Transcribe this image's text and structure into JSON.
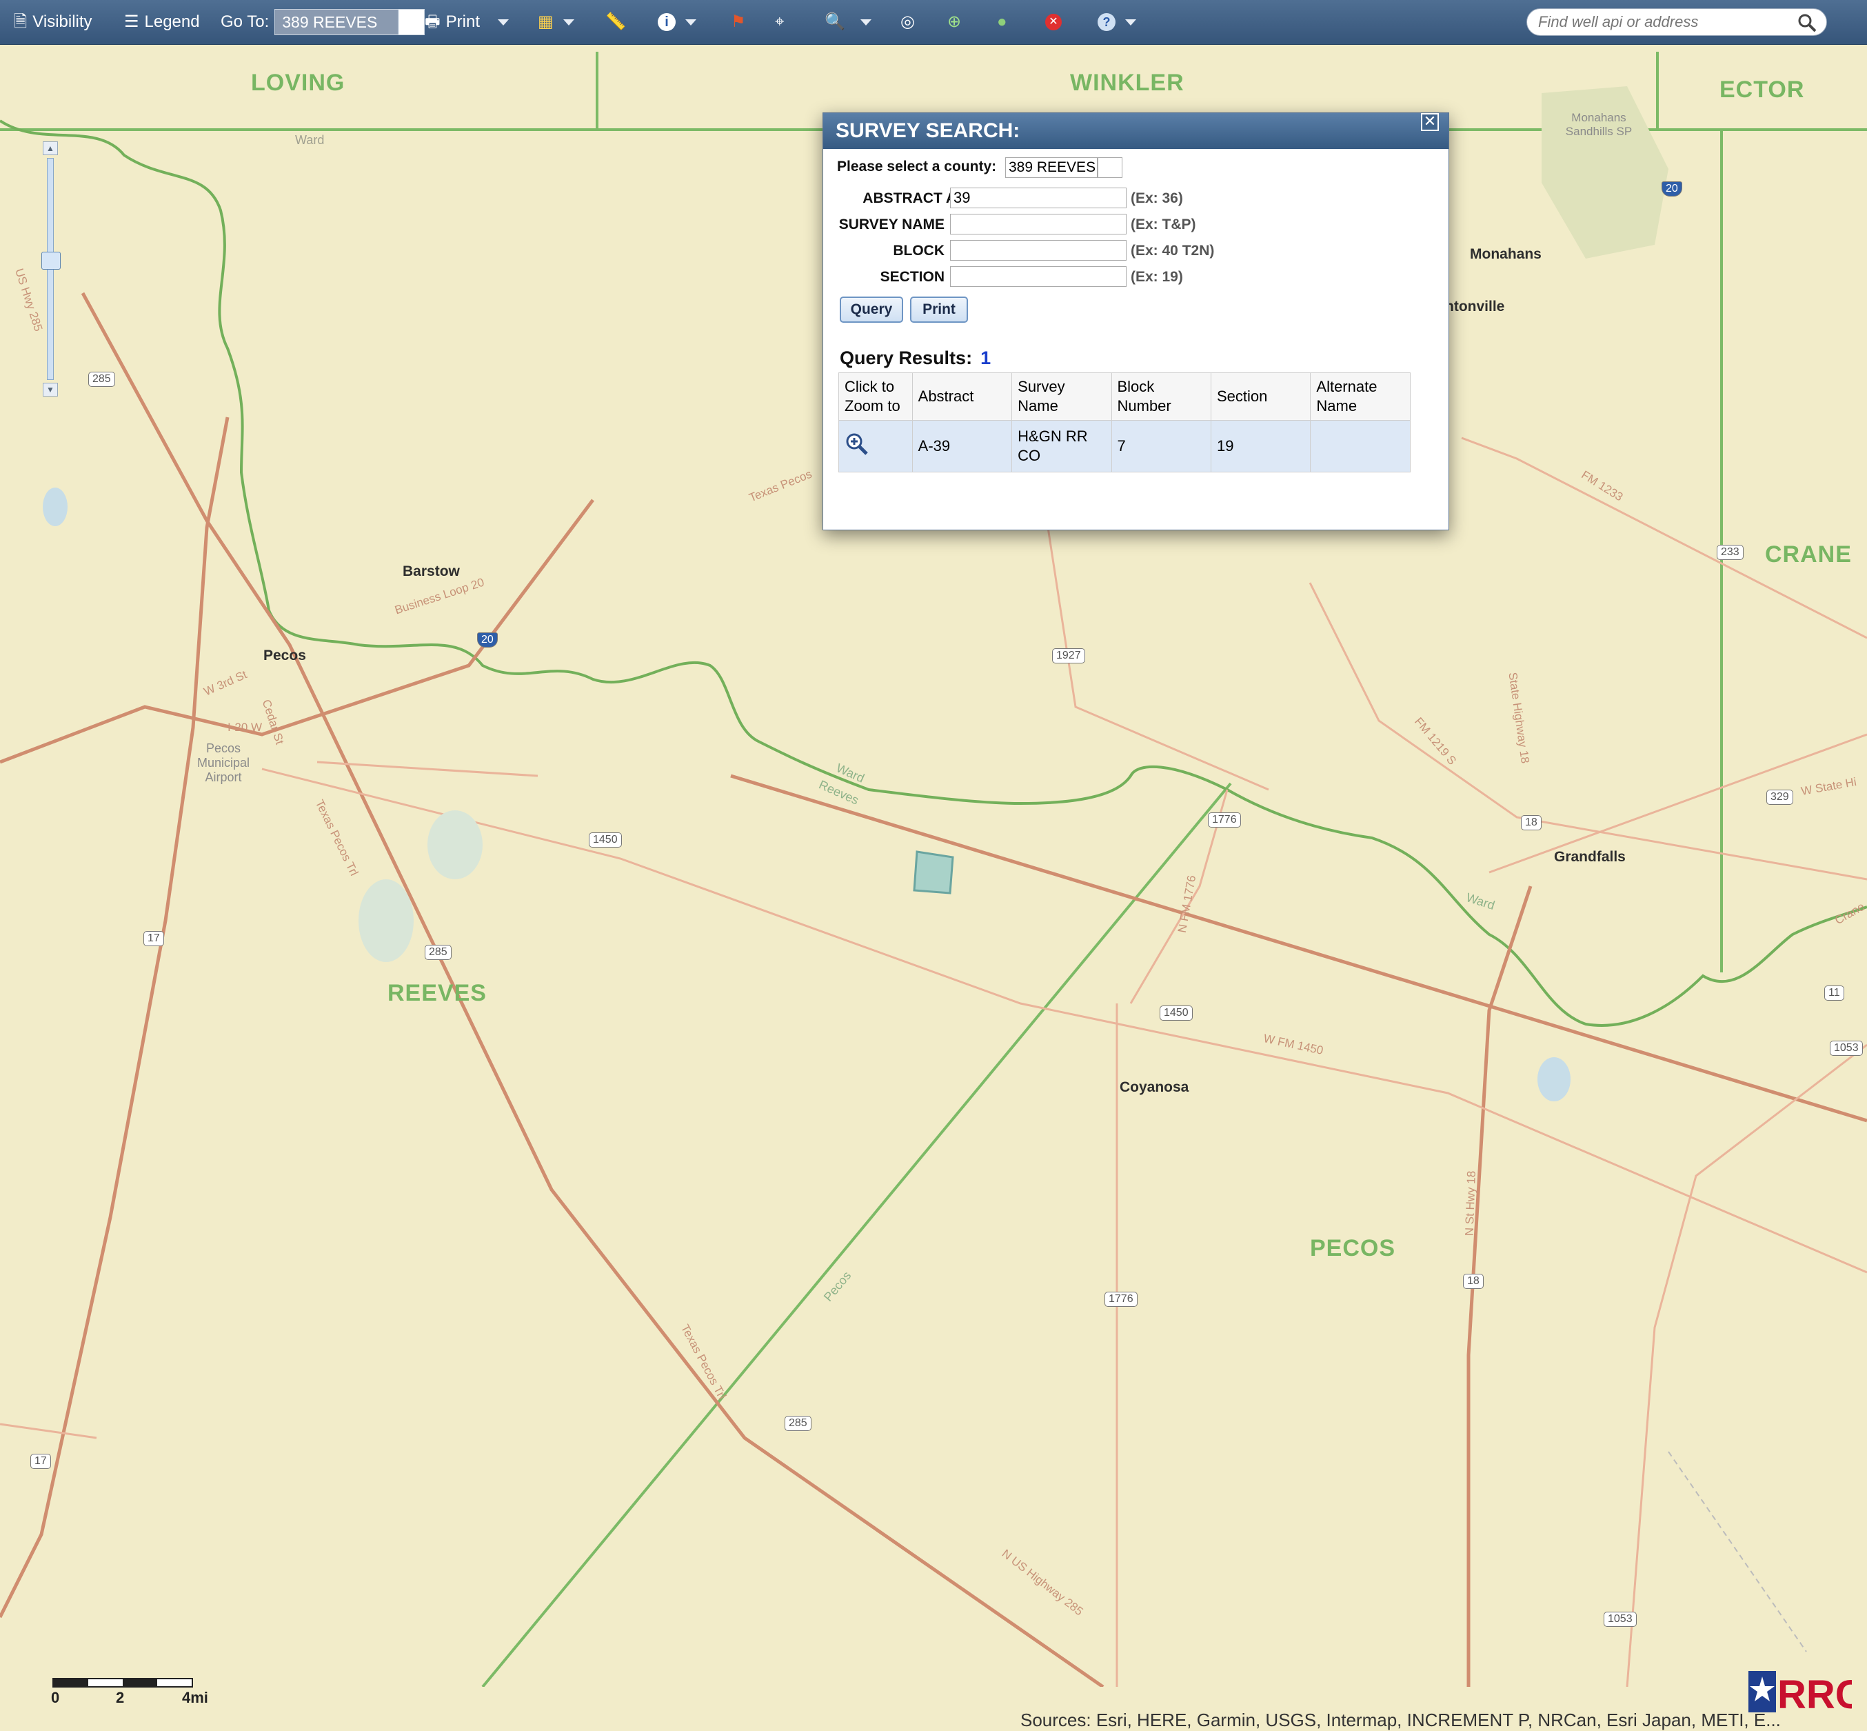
{
  "toolbar": {
    "visibility": "Visibility",
    "legend": "Legend",
    "goto_label": "Go To:",
    "goto_value": "389 REEVES",
    "print": "Print",
    "search_placeholder": "Find well api or address"
  },
  "map": {
    "counties": [
      "LOVING",
      "WINKLER",
      "ECTOR",
      "CRANE",
      "REEVES",
      "PECOS"
    ],
    "towns": [
      "Barstow",
      "Pecos",
      "Monahans",
      "Grandfalls",
      "Coyanosa",
      "Pecos Municipal Airport",
      "Monahans Sandhills SP",
      "ntonville"
    ],
    "roads": [
      "Texas Pecos",
      "Business Loop 20",
      "W 3rd St",
      "Cedar St",
      "I-20 W",
      "Texas Pecos Trl",
      "FM 1233",
      "FM 1219 S",
      "State Highway 18",
      "N FM 1776",
      "W FM 1450",
      "W State Hi",
      "N St Hwy 18",
      "N US Highway 285",
      "US Hwy 285",
      "Texas Pecos Trl",
      "Crane"
    ],
    "shields": [
      "285",
      "20",
      "1927",
      "1450",
      "1776",
      "17",
      "285",
      "18",
      "233",
      "329",
      "11",
      "1053",
      "1450",
      "18",
      "1776",
      "285",
      "17",
      "1053",
      "20"
    ],
    "boundary_labels": [
      "Ward",
      "Ward",
      "Reeves",
      "Ward",
      "Pecos"
    ],
    "scale": {
      "ticks": [
        "0",
        "2",
        "4mi"
      ]
    },
    "attribution": "Sources: Esri, HERE, Garmin, USGS, Intermap, INCREMENT P, NRCan, Esri Japan, METI, E...",
    "logo": "RRC"
  },
  "dialog": {
    "title": "SURVEY SEARCH:",
    "county_label": "Please select a county:",
    "county_value": "389 REEVES",
    "abstract_label": "ABSTRACT A-",
    "abstract_value": "39",
    "abstract_ex": "(Ex: 36)",
    "survey_label": "SURVEY NAME",
    "survey_value": "",
    "survey_ex": "(Ex: T&P)",
    "block_label": "BLOCK",
    "block_value": "",
    "block_ex": "(Ex: 40 T2N)",
    "section_label": "SECTION",
    "section_value": "",
    "section_ex": "(Ex: 19)",
    "query_btn": "Query",
    "print_btn": "Print",
    "results_label": "Query Results:",
    "results_count": "1",
    "columns": [
      "Click to Zoom to",
      "Abstract",
      "Survey Name",
      "Block Number",
      "Section",
      "Alternate Name"
    ],
    "rows": [
      {
        "abstract": "A-39",
        "survey_name": "H&GN RR CO",
        "block": "7",
        "section": "19",
        "alternate": ""
      }
    ]
  }
}
